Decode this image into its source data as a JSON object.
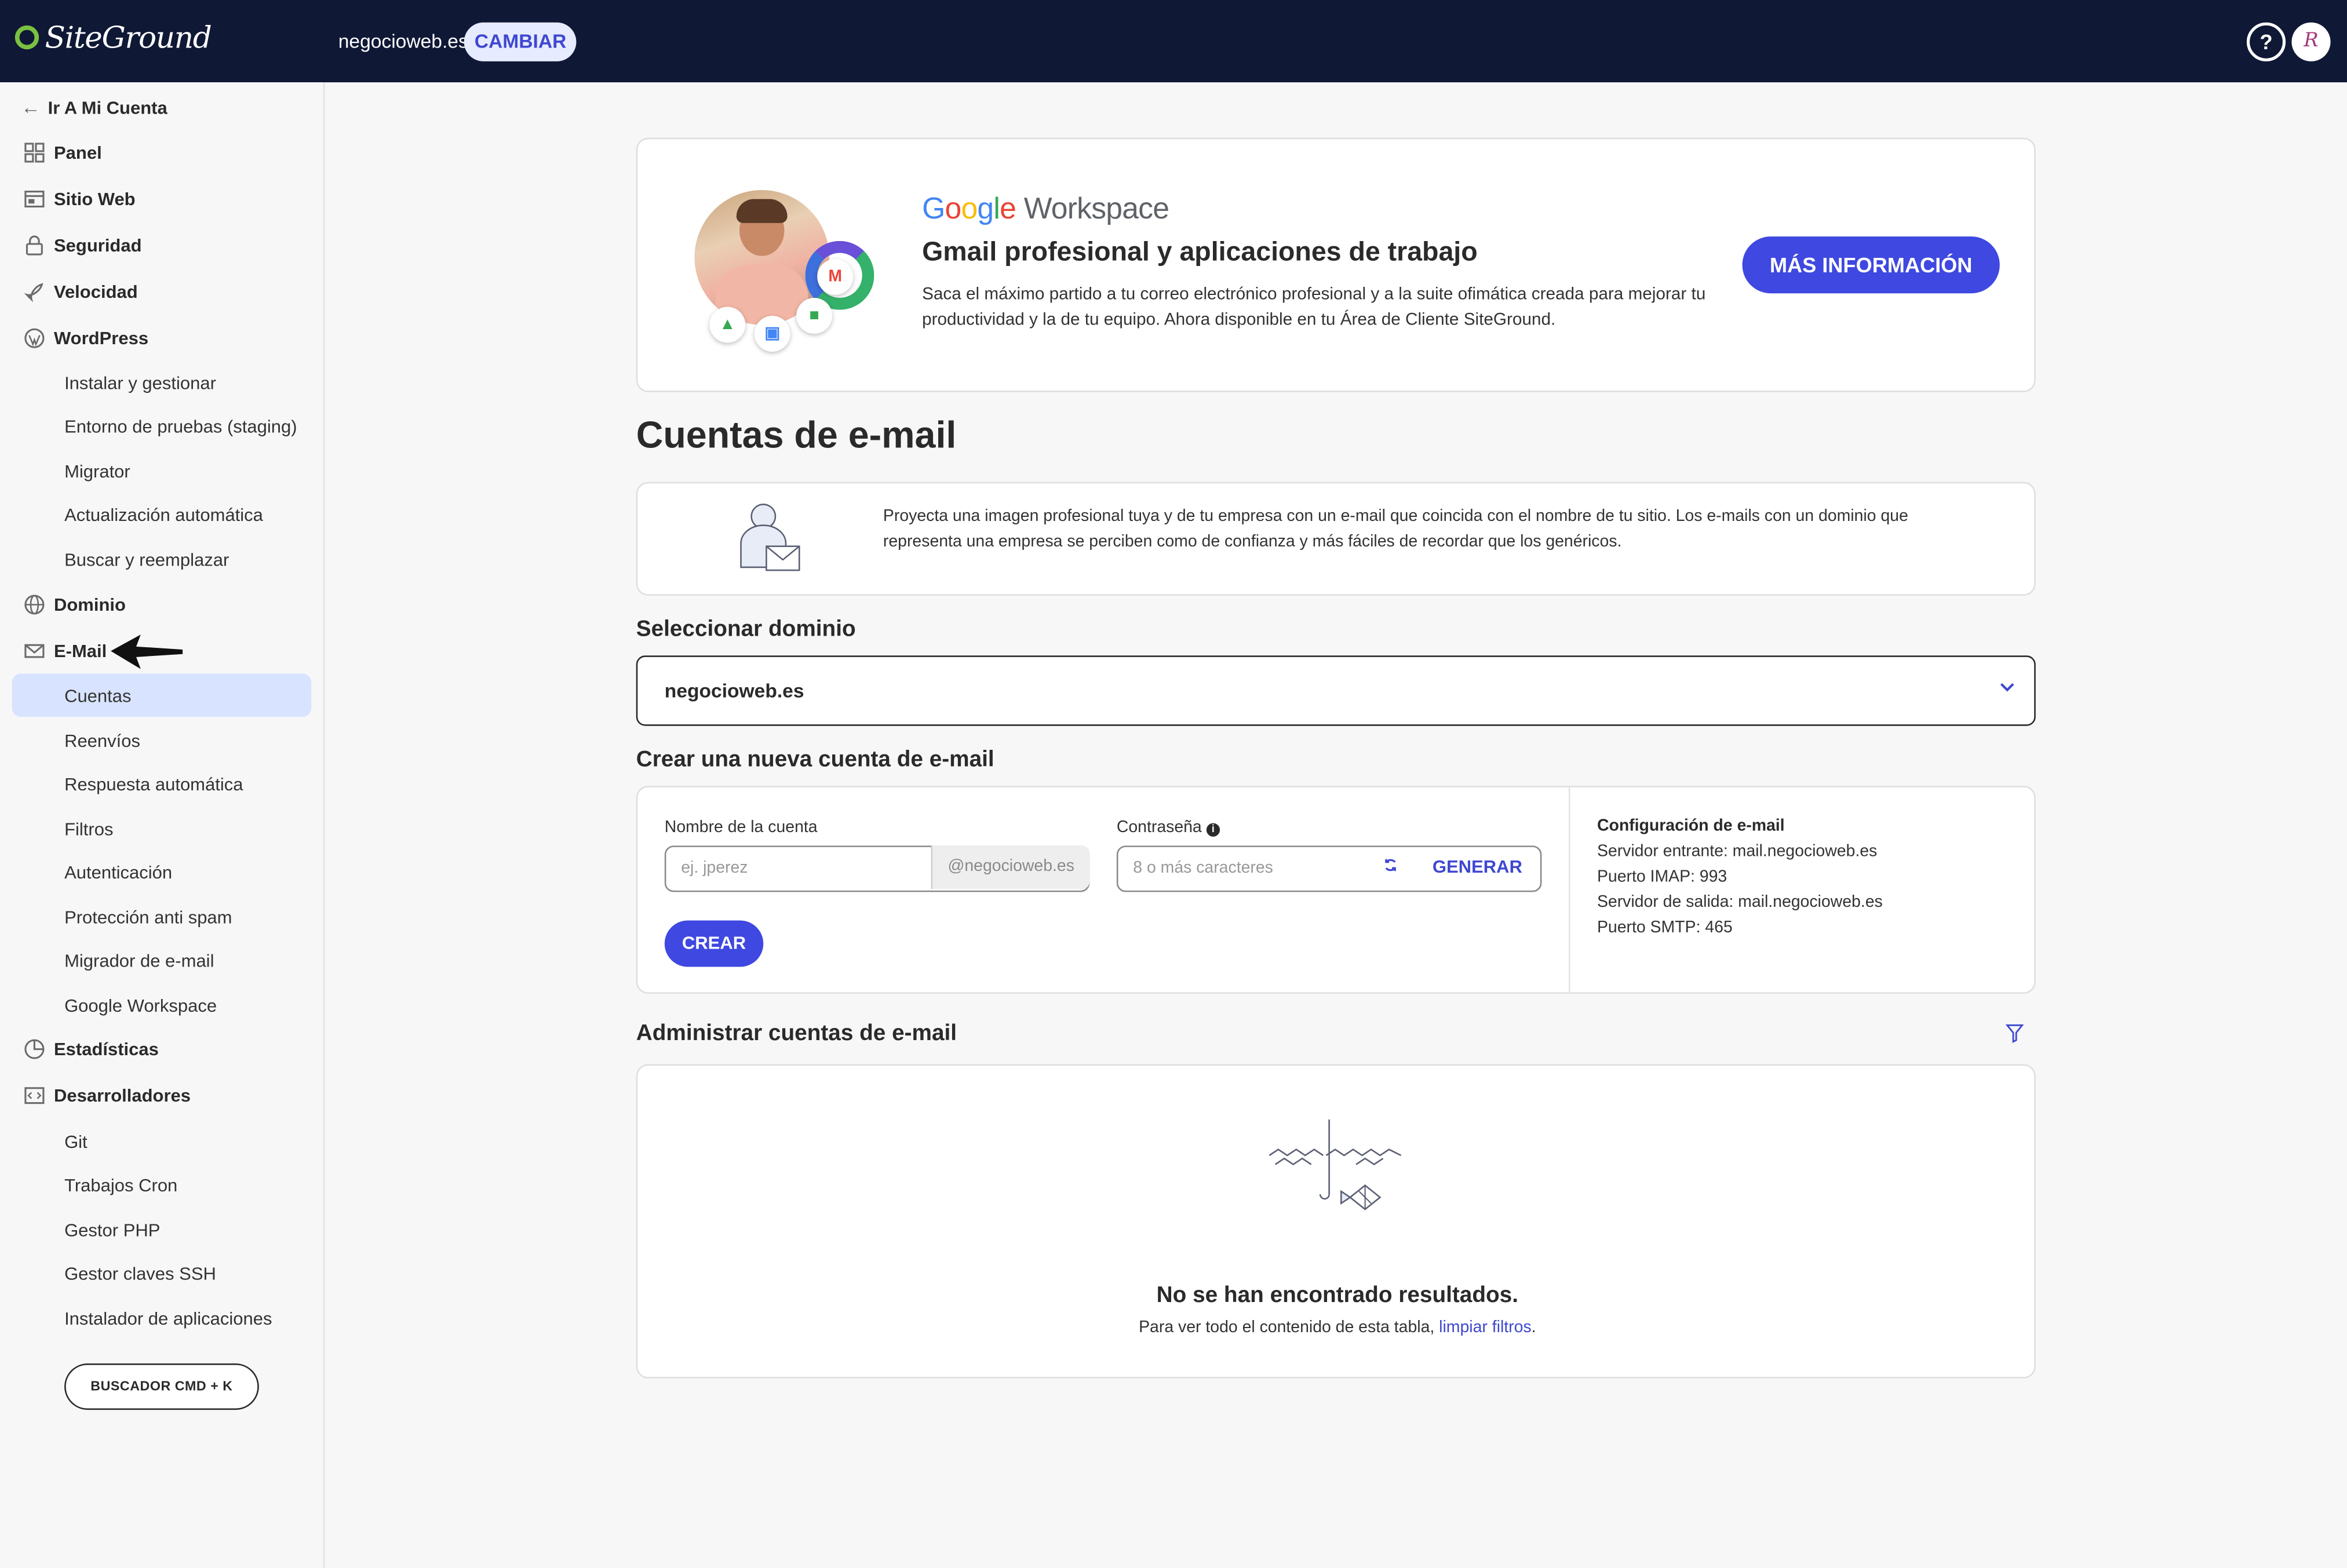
{
  "topbar": {
    "logo_text": "SiteGround",
    "domain": "negocioweb.es",
    "change_label": "CAMBIAR",
    "help_label": "?",
    "avatar_initials": "R"
  },
  "sidebar": {
    "back_label": "Ir A Mi Cuenta",
    "items": [
      {
        "label": "Panel",
        "icon": "grid-icon"
      },
      {
        "label": "Sitio Web",
        "icon": "browser-icon"
      },
      {
        "label": "Seguridad",
        "icon": "lock-icon"
      },
      {
        "label": "Velocidad",
        "icon": "rocket-icon"
      },
      {
        "label": "WordPress",
        "icon": "wordpress-icon"
      }
    ],
    "wordpress_sub": [
      "Instalar y gestionar",
      "Entorno de pruebas (staging)",
      "Migrator",
      "Actualización automática",
      "Buscar y reemplazar"
    ],
    "domain_label": "Dominio",
    "email_label": "E-Mail",
    "email_sub": [
      "Cuentas",
      "Reenvíos",
      "Respuesta automática",
      "Filtros",
      "Autenticación",
      "Protección anti spam",
      "Migrador de e-mail",
      "Google Workspace"
    ],
    "stats_label": "Estadísticas",
    "dev_label": "Desarrolladores",
    "dev_sub": [
      "Git",
      "Trabajos Cron",
      "Gestor PHP",
      "Gestor claves SSH",
      "Instalador de aplicaciones"
    ],
    "search_button": "BUSCADOR CMD + K"
  },
  "promo": {
    "google": [
      "G",
      "o",
      "o",
      "g",
      "l",
      "e"
    ],
    "workspace": "Workspace",
    "title": "Gmail profesional y aplicaciones de trabajo",
    "description": "Saca el máximo partido a tu correo electrónico profesional y a la suite ofimática creada para mejorar tu productividad y la de tu equipo. Ahora disponible en tu Área de Cliente SiteGround.",
    "button": "MÁS INFORMACIÓN"
  },
  "page": {
    "title": "Cuentas de e-mail",
    "intro": "Proyecta una imagen profesional tuya y de tu empresa con un e-mail que coincida con el nombre de tu sitio. Los e-mails con un dominio que representa una empresa se perciben como de confianza y más fáciles de recordar que los genéricos."
  },
  "select_domain": {
    "label": "Seleccionar dominio",
    "value": "negocioweb.es"
  },
  "create": {
    "heading": "Crear una nueva cuenta de e-mail",
    "account_label": "Nombre de la cuenta",
    "account_placeholder": "ej. jperez",
    "account_suffix": "@negocioweb.es",
    "password_label": "Contraseña",
    "password_placeholder": "8 o más caracteres",
    "generate_label": "GENERAR",
    "create_button": "CREAR",
    "config_title": "Configuración de e-mail",
    "config_lines": [
      "Servidor entrante: mail.negocioweb.es",
      "Puerto IMAP: 993",
      "Servidor de salida: mail.negocioweb.es",
      "Puerto SMTP: 465"
    ]
  },
  "manage": {
    "heading": "Administrar cuentas de e-mail",
    "empty_title": "No se han encontrado resultados.",
    "empty_text": "Para ver todo el contenido de esta tabla, ",
    "empty_link": "limpiar filtros",
    "empty_end": "."
  },
  "colors": {
    "topbar": "#0f1835",
    "accent": "#3f48e0",
    "active_item": "#d8e4ff",
    "logo_green": "#7ac142"
  }
}
